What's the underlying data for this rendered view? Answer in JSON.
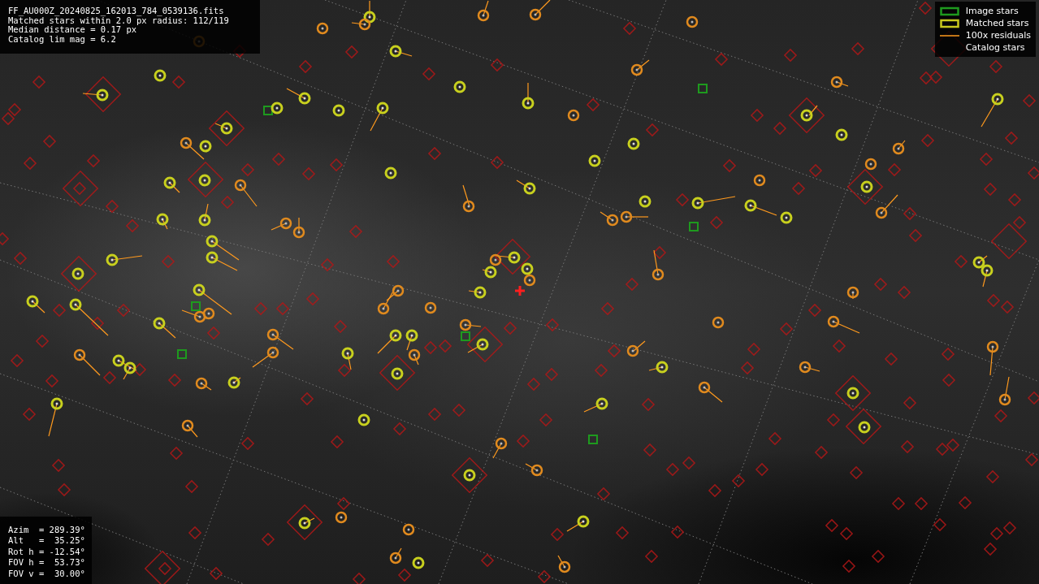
{
  "info_box": {
    "lines": [
      "FF_AU000Z_20240825_162013_784_0539136.fits",
      "Matched stars within 2.0 px radius: 112/119",
      "Median distance = 0.17 px",
      "Catalog lim mag = 6.2"
    ]
  },
  "legend": {
    "items": [
      {
        "kind": "image",
        "label": "Image stars"
      },
      {
        "kind": "matched",
        "label": "Matched stars"
      },
      {
        "kind": "residual",
        "label": "100x residuals"
      },
      {
        "kind": "catalog",
        "label": "Catalog stars"
      }
    ]
  },
  "pointing_box": {
    "lines": [
      "Azim  = 289.39°",
      "Alt   =  35.25°",
      "Rot h = -12.54°",
      "FOV h =  53.73°",
      "FOV v =  30.00°"
    ]
  }
}
